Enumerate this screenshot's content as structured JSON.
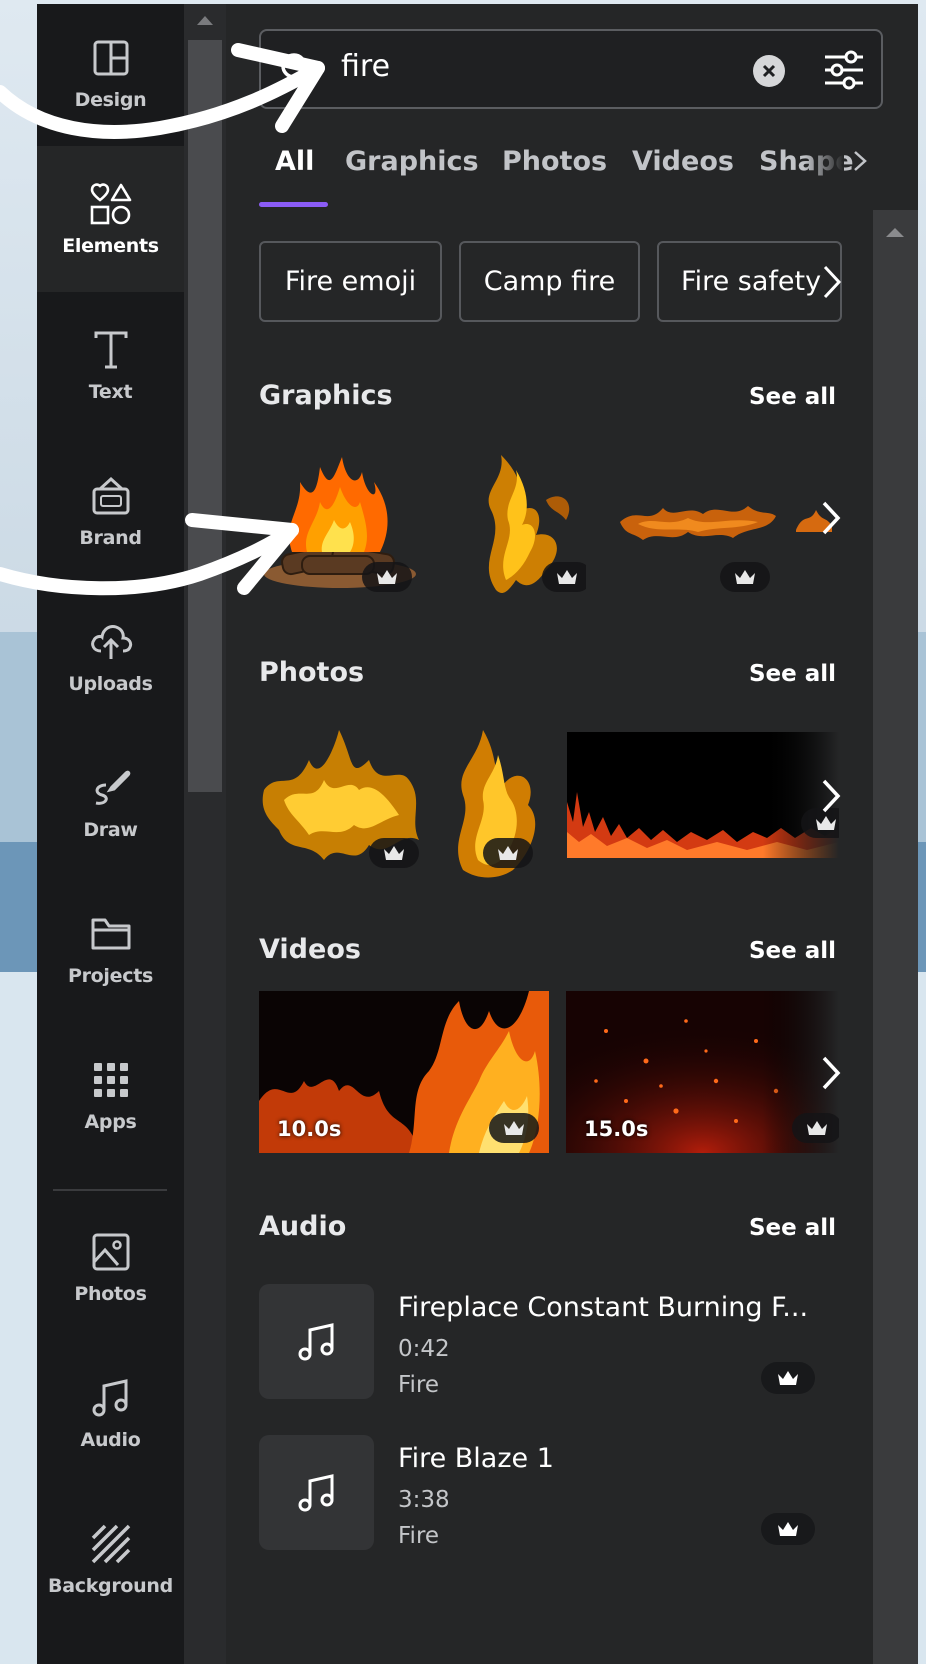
{
  "rail": {
    "items": [
      {
        "label": "Design",
        "icon": "layout-icon"
      },
      {
        "label": "Elements",
        "icon": "shapes-icon"
      },
      {
        "label": "Text",
        "icon": "text-icon"
      },
      {
        "label": "Brand",
        "icon": "brand-bag-icon"
      },
      {
        "label": "Uploads",
        "icon": "cloud-upload-icon"
      },
      {
        "label": "Draw",
        "icon": "pen-icon"
      },
      {
        "label": "Projects",
        "icon": "folder-icon"
      },
      {
        "label": "Apps",
        "icon": "grid-icon"
      },
      {
        "label": "Photos",
        "icon": "image-icon"
      },
      {
        "label": "Audio",
        "icon": "music-note-icon"
      },
      {
        "label": "Background",
        "icon": "hatch-icon"
      }
    ]
  },
  "search": {
    "value": "fire"
  },
  "tabs": [
    {
      "label": "All"
    },
    {
      "label": "Graphics"
    },
    {
      "label": "Photos"
    },
    {
      "label": "Videos"
    },
    {
      "label": "Shape"
    }
  ],
  "chips": [
    {
      "label": "Fire emoji"
    },
    {
      "label": "Camp fire"
    },
    {
      "label": "Fire safety"
    }
  ],
  "sections": {
    "graphics": {
      "title": "Graphics",
      "see_all": "See all"
    },
    "photos": {
      "title": "Photos",
      "see_all": "See all"
    },
    "videos": {
      "title": "Videos",
      "see_all": "See all"
    },
    "audio": {
      "title": "Audio",
      "see_all": "See all"
    }
  },
  "videos": [
    {
      "duration": "10.0s"
    },
    {
      "duration": "15.0s"
    }
  ],
  "audio": [
    {
      "title": "Fireplace Constant Burning F...",
      "duration": "0:42",
      "tag": "Fire"
    },
    {
      "title": "Fire Blaze 1",
      "duration": "3:38",
      "tag": "Fire"
    }
  ],
  "colors": {
    "panel_bg": "#252627",
    "rail_bg": "#18191b",
    "accent": "#8b5cf6"
  }
}
